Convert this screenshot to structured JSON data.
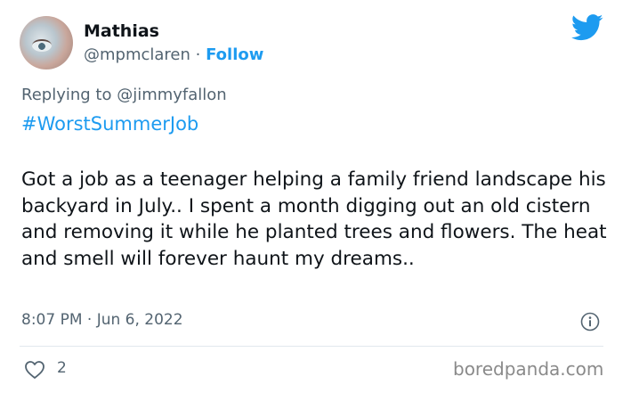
{
  "author": {
    "name": "Mathias",
    "handle": "@mpmclaren",
    "separator": " · ",
    "follow_label": "Follow"
  },
  "reply": {
    "prefix": "Replying to ",
    "mention": "@jimmyfallon"
  },
  "hashtag": "#WorstSummerJob",
  "tweet_text": "Got a job as a teenager helping a family friend landscape his backyard in July.. I spent a month digging out an old cistern and removing it while he planted trees and flowers. The heat and smell will forever haunt my dreams..",
  "timestamp": "8:07 PM · Jun 6, 2022",
  "likes": "2",
  "watermark": "boredpanda.com",
  "icons": {
    "logo": "twitter-bird-icon",
    "info": "info-icon",
    "like": "heart-icon"
  },
  "colors": {
    "accent": "#1d9bf0",
    "text": "#0f1419",
    "secondary": "#536471"
  }
}
